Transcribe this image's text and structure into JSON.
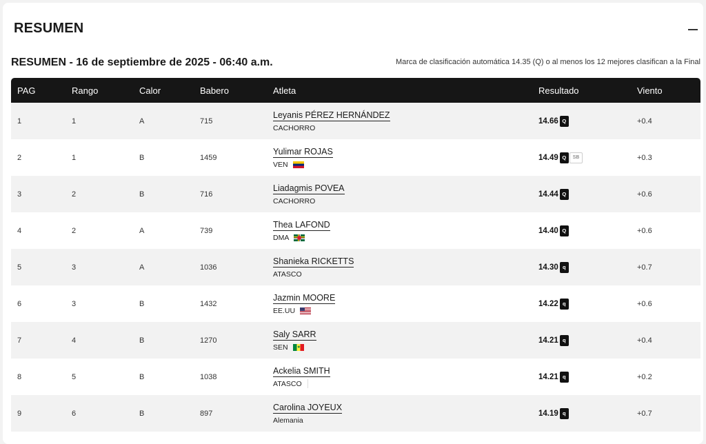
{
  "card": {
    "title": "RESUMEN"
  },
  "summary": {
    "title": "RESUMEN - 16 de septiembre de 2025 - 06:40 a.m.",
    "note": "Marca de clasificación automática 14.35 (Q) o al menos los 12 mejores clasifican a la Final"
  },
  "columns": [
    "PAG",
    "Rango",
    "Calor",
    "Babero",
    "Atleta",
    "Resultado",
    "Viento"
  ],
  "rows": [
    {
      "pag": "1",
      "rango": "1",
      "calor": "A",
      "babero": "715",
      "name": "Leyanis PÉREZ HERNÁNDEZ",
      "team": "CACHORRO",
      "flag": "",
      "result": "14.66",
      "qual": "Q",
      "sb": "",
      "wind": "+0.4"
    },
    {
      "pag": "2",
      "rango": "1",
      "calor": "B",
      "babero": "1459",
      "name": "Yulimar ROJAS",
      "team": "VEN",
      "flag": "VEN",
      "result": "14.49",
      "qual": "Q",
      "sb": "SB",
      "wind": "+0.3"
    },
    {
      "pag": "3",
      "rango": "2",
      "calor": "B",
      "babero": "716",
      "name": "Liadagmis POVEA",
      "team": "CACHORRO",
      "flag": "",
      "result": "14.44",
      "qual": "Q",
      "sb": "",
      "wind": "+0.6"
    },
    {
      "pag": "4",
      "rango": "2",
      "calor": "A",
      "babero": "739",
      "name": "Thea LAFOND",
      "team": "DMA",
      "flag": "DMA",
      "result": "14.40",
      "qual": "Q",
      "sb": "",
      "wind": "+0.6"
    },
    {
      "pag": "5",
      "rango": "3",
      "calor": "A",
      "babero": "1036",
      "name": "Shanieka RICKETTS",
      "team": "ATASCO",
      "flag": "",
      "result": "14.30",
      "qual": "q",
      "sb": "",
      "wind": "+0.7"
    },
    {
      "pag": "6",
      "rango": "3",
      "calor": "B",
      "babero": "1432",
      "name": "Jazmin MOORE",
      "team": "EE.UU",
      "flag": "USA",
      "result": "14.22",
      "qual": "q",
      "sb": "",
      "wind": "+0.6"
    },
    {
      "pag": "7",
      "rango": "4",
      "calor": "B",
      "babero": "1270",
      "name": "Saly SARR",
      "team": "SEN",
      "flag": "SEN",
      "result": "14.21",
      "qual": "q",
      "sb": "",
      "wind": "+0.4"
    },
    {
      "pag": "8",
      "rango": "5",
      "calor": "B",
      "babero": "1038",
      "name": "Ackelia SMITH",
      "team": "ATASCO",
      "flag": "line",
      "result": "14.21",
      "qual": "q",
      "sb": "",
      "wind": "+0.2"
    },
    {
      "pag": "9",
      "rango": "6",
      "calor": "B",
      "babero": "897",
      "name": "Carolina JOYEUX",
      "team": "Alemania",
      "flag": "",
      "result": "14.19",
      "qual": "q",
      "sb": "",
      "wind": "+0.7"
    }
  ]
}
